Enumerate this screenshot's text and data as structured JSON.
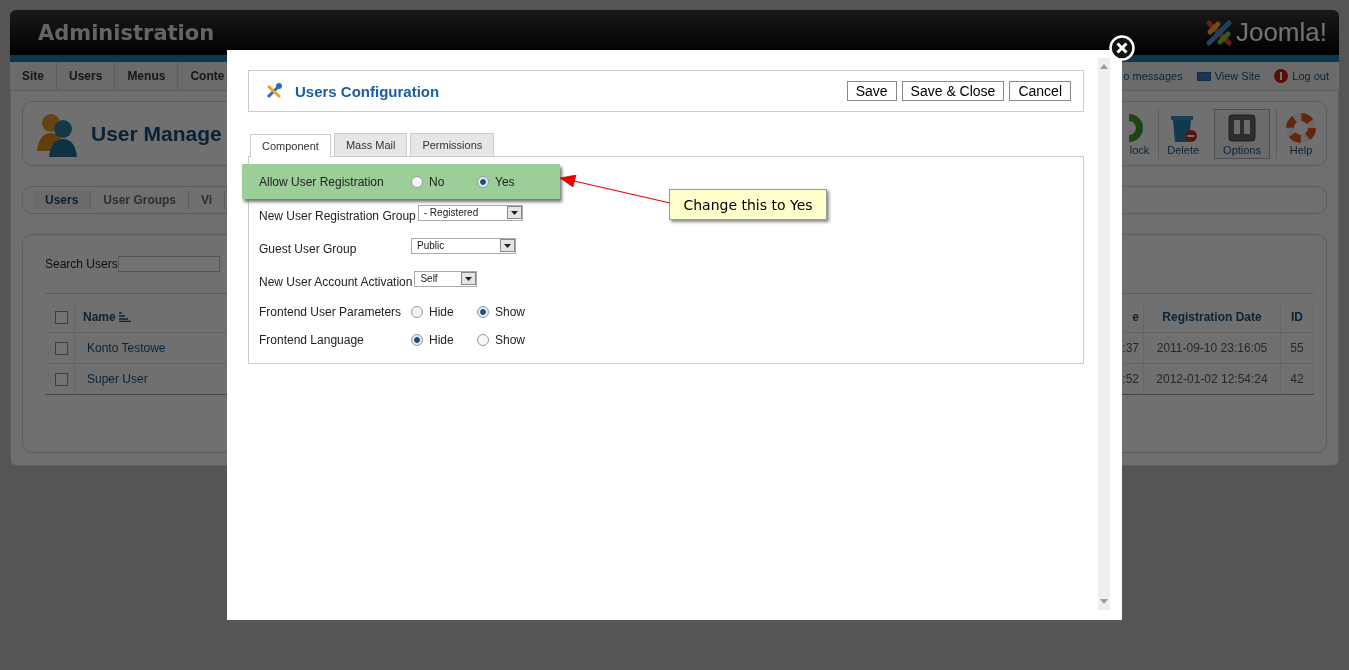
{
  "header": {
    "title": "Administration",
    "logo": "Joomla!"
  },
  "menu": [
    "Site",
    "Users",
    "Menus",
    "Conte"
  ],
  "status_links": [
    {
      "kind": "messages",
      "label": "o messages"
    },
    {
      "kind": "view",
      "label": "View Site"
    },
    {
      "kind": "logout",
      "label": "Log out"
    }
  ],
  "page_title": "User Manage",
  "toolbar": [
    {
      "kind": "unblock",
      "label": "lock",
      "selected": false
    },
    {
      "kind": "delete",
      "label": "Delete",
      "selected": false
    },
    {
      "kind": "options",
      "label": "Options",
      "selected": true
    },
    {
      "kind": "help",
      "label": "Help",
      "selected": false
    }
  ],
  "subnav": [
    {
      "label": "Users",
      "selected": true
    },
    {
      "label": "User Groups",
      "selected": false
    },
    {
      "label": "Vi",
      "selected": false
    }
  ],
  "search": {
    "label": "Search Users"
  },
  "table": {
    "select_all_checked": false,
    "columns": [
      "Name",
      "e",
      "Registration Date",
      "ID"
    ],
    "rows": [
      {
        "checked": false,
        "name": "Konto Testowe",
        "column_2": ":37",
        "date": "2011-09-10 23:16:05",
        "id": "55"
      },
      {
        "checked": false,
        "name": "Super User",
        "column_2": ":52",
        "date": "2012-01-02 12:54:24",
        "id": "42"
      }
    ]
  },
  "dialog": {
    "title": "Users Configuration",
    "buttons": [
      "Save",
      "Save & Close",
      "Cancel"
    ],
    "tabs": [
      {
        "label": "Component",
        "selected": true
      },
      {
        "label": "Mass Mail",
        "selected": false
      },
      {
        "label": "Permissions",
        "selected": false
      }
    ],
    "fields": [
      {
        "kind": "radio",
        "label": "Allow User Registration",
        "highlighted": true,
        "options": [
          {
            "label": "No",
            "selected": false
          },
          {
            "label": "Yes",
            "selected": true
          }
        ]
      },
      {
        "kind": "select",
        "label": "New User Registration Group",
        "highlighted": false,
        "value": "- Registered"
      },
      {
        "kind": "select",
        "label": "Guest User Group",
        "highlighted": false,
        "value": "Public"
      },
      {
        "kind": "select",
        "label": "New User Account Activation",
        "highlighted": false,
        "value": "Self"
      },
      {
        "kind": "radio",
        "label": "Frontend User Parameters",
        "highlighted": false,
        "options": [
          {
            "label": "Hide",
            "selected": false
          },
          {
            "label": "Show",
            "selected": true
          }
        ]
      },
      {
        "kind": "radio",
        "label": "Frontend Language",
        "highlighted": false,
        "options": [
          {
            "label": "Hide",
            "selected": true
          },
          {
            "label": "Show",
            "selected": false
          }
        ]
      }
    ],
    "callout": "Change this to Yes"
  }
}
